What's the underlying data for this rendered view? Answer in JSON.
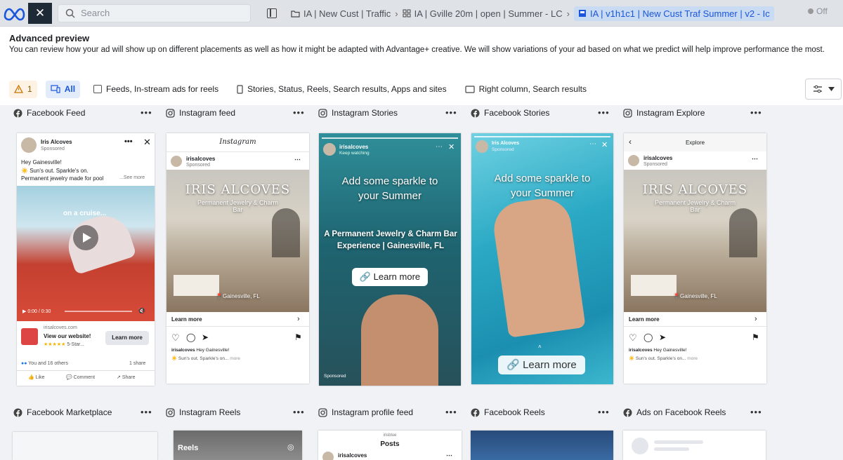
{
  "topbar": {
    "search_placeholder": "Search",
    "breadcrumbs": [
      {
        "label": "IA | New Cust | Traffic",
        "icon": "folder-icon"
      },
      {
        "label": "IA | Gville 20m | open | Summer - LC",
        "icon": "grid-icon"
      },
      {
        "label": "IA | v1h1c1 | New Cust Traf Summer | v2 - Ic",
        "icon": "ad-icon"
      }
    ],
    "toggle_label": "Off"
  },
  "header": {
    "title": "Advanced preview",
    "subtitle": "You can review how your ad will show up on different placements as well as how it might be adapted with Advantage+ creative. We will show variations of your ad based on what we predict will help improve performance the most."
  },
  "filters": {
    "warning_count": "1",
    "all_label": "All",
    "feeds_label": "Feeds, In-stream ads for reels",
    "stories_label": "Stories, Status, Reels, Search results, Apps and sites",
    "right_column_label": "Right column, Search results"
  },
  "placements_row1": [
    {
      "label": "Facebook Feed",
      "platform": "facebook"
    },
    {
      "label": "Instagram feed",
      "platform": "instagram"
    },
    {
      "label": "Instagram Stories",
      "platform": "instagram"
    },
    {
      "label": "Facebook Stories",
      "platform": "facebook"
    },
    {
      "label": "Instagram Explore",
      "platform": "instagram"
    }
  ],
  "placements_row2": [
    {
      "label": "Facebook Marketplace",
      "platform": "facebook"
    },
    {
      "label": "Instagram Reels",
      "platform": "instagram"
    },
    {
      "label": "Instagram profile feed",
      "platform": "instagram"
    },
    {
      "label": "Facebook Reels",
      "platform": "facebook"
    },
    {
      "label": "Ads on Facebook Reels",
      "platform": "facebook"
    }
  ],
  "fb_feed": {
    "page_name": "Iris Alcoves",
    "sponsored": "Sponsored",
    "text_line1": "Hey Gainesville!",
    "text_line2": "Sun's out. Sparkle's on.",
    "text_line3": "Permanent jewelry made for pool",
    "see_more": "...See more",
    "video_caption": "on a cruise...",
    "video_time": "0:00 / 0:30",
    "domain": "irisalcoves.com",
    "cta_title": "View our website!",
    "cta_sub": "5-Star...",
    "cta_button": "Learn more",
    "reactions": "You and 16 others",
    "shares": "1 share",
    "like": "Like",
    "comment": "Comment",
    "share": "Share"
  },
  "ig_feed": {
    "wordmark": "Instagram",
    "handle": "irisalcoves",
    "sponsored": "Sponsored",
    "overlay_title": "IRIS ALCOVES",
    "overlay_sub": "Permanent Jewelry & Charm Bar",
    "location": "Gainesville, FL",
    "cta": "Learn more",
    "caption_user": "irisalcoves",
    "caption": "Hey Gainesville!",
    "caption2": "Sun's out. Sparkle's on...",
    "more": "more"
  },
  "ig_stories": {
    "handle": "irisalcoves",
    "sub": "Keep watching",
    "headline": "Add some sparkle to your Summer",
    "body": "A Permanent Jewelry & Charm Bar Experience | Gainesville, FL",
    "cta": "Learn more",
    "sponsored": "Sponsored"
  },
  "fb_stories": {
    "page_name": "Iris Alcoves",
    "sponsored": "Sponsored",
    "headline": "Add some sparkle to your Summer",
    "cta": "Learn more"
  },
  "ig_explore": {
    "header": "Explore",
    "handle": "irisalcoves",
    "sponsored": "Sponsored",
    "overlay_title": "IRIS ALCOVES",
    "overlay_sub": "Permanent Jewelry & Charm Bar",
    "location": "Gainesville, FL",
    "cta": "Learn more",
    "caption_user": "irisalcoves",
    "caption": "Hey Gainesville!",
    "caption2": "Sun's out. Sparkle's on...",
    "more": "more"
  },
  "ig_reels": {
    "label": "Reels"
  },
  "ig_profile": {
    "top": "irisblue",
    "title": "Posts",
    "handle": "irisalcoves"
  },
  "colors": {
    "accent": "#1a56db",
    "fb_blue": "#1877f2",
    "pool": "#2aa9c4"
  }
}
